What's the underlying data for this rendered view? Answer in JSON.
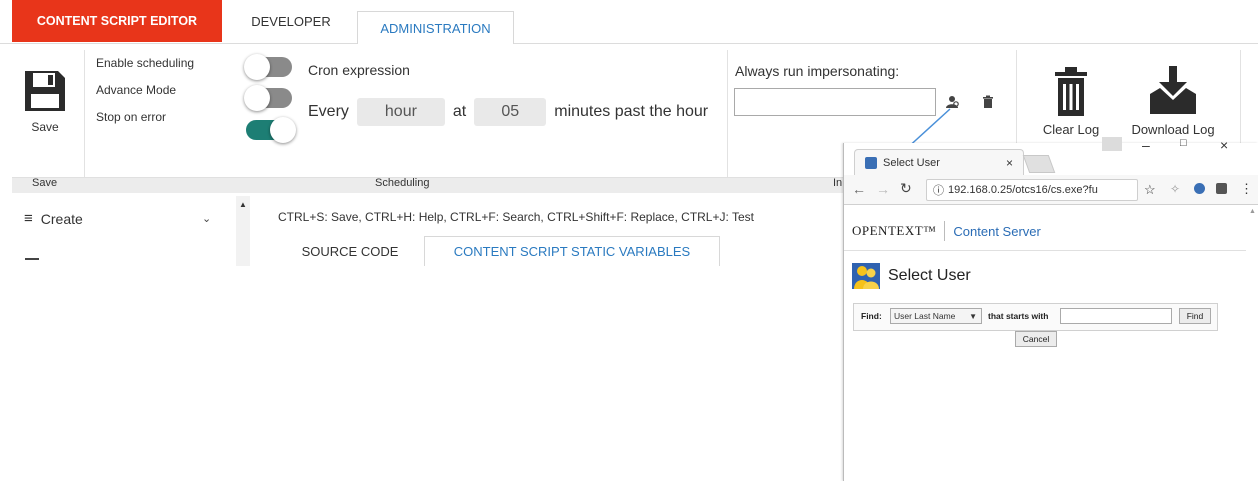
{
  "tabs": {
    "content_script_editor": "CONTENT SCRIPT EDITOR",
    "developer": "DEVELOPER",
    "administration": "ADMINISTRATION"
  },
  "ribbon": {
    "save_label": "Save",
    "group_save": "Save",
    "group_scheduling": "Scheduling",
    "group_impersonation": "In",
    "options": {
      "enable_scheduling": "Enable scheduling",
      "advance_mode": "Advance Mode",
      "stop_on_error": "Stop on error"
    },
    "toggles": {
      "enable_scheduling": false,
      "advance_mode": false,
      "stop_on_error": true
    },
    "cron": {
      "title": "Cron expression",
      "every": "Every",
      "unit": "hour",
      "at": "at",
      "minutes": "05",
      "suffix": "minutes past the hour"
    },
    "impersonation": {
      "title": "Always run impersonating:",
      "value": ""
    },
    "clear_log": "Clear Log",
    "download_log": "Download Log"
  },
  "left_panel": {
    "create": "Create"
  },
  "editor": {
    "hotkeys": "CTRL+S: Save, CTRL+H: Help, CTRL+F: Search, CTRL+Shift+F: Replace, CTRL+J: Test",
    "tab_source": "SOURCE CODE",
    "tab_vars": "CONTENT SCRIPT STATIC VARIABLES"
  },
  "popup": {
    "tab_title": "Select User",
    "url": "192.168.0.25/otcs16/cs.exe?fu",
    "brand_opentext": "OPENTEXT™",
    "brand_cs": "Content Server",
    "heading": "Select User",
    "find_label": "Find:",
    "find_field": "User Last Name",
    "starts_with": "that starts with",
    "find_value": "",
    "find_button": "Find",
    "cancel_button": "Cancel"
  },
  "colors": {
    "accent_red": "#e8351a",
    "link_blue": "#2a7ac0",
    "toggle_on": "#1d7e74"
  }
}
